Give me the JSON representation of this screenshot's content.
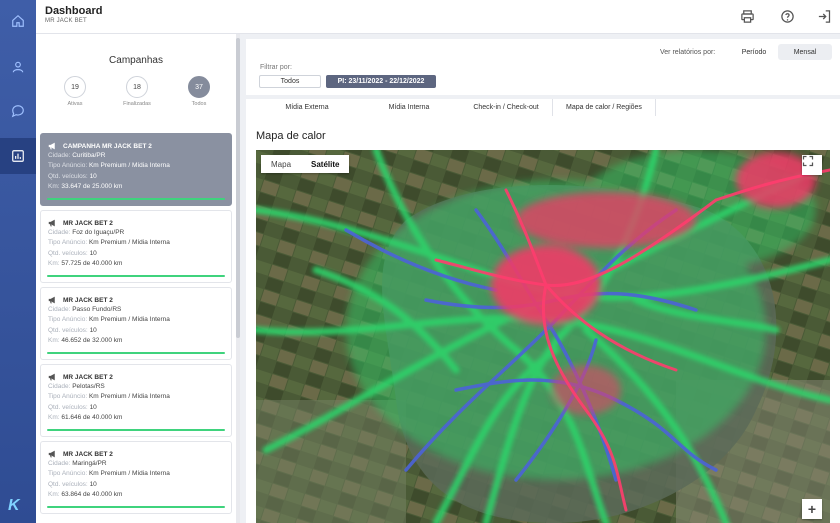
{
  "header": {
    "title": "Dashboard",
    "subtitle": "MR JACK BET"
  },
  "rail": {
    "icons": [
      "home-icon",
      "user-icon",
      "chat-icon",
      "chart-icon"
    ],
    "active": "chart-icon",
    "logo": "K"
  },
  "campaigns": {
    "title": "Campanhas",
    "counters": [
      {
        "value": "19",
        "label": "Ativas"
      },
      {
        "value": "18",
        "label": "Finalizadas"
      },
      {
        "value": "37",
        "label": "Todos"
      }
    ],
    "labels": {
      "cidade": "Cidade:",
      "tipo": "Tipo Anúncio:",
      "qtd": "Qtd. veículos:",
      "km": "Km:"
    },
    "items": [
      {
        "name": "CAMPANHA MR JACK BET 2",
        "cidade": "Curitiba/PR",
        "tipo": "Km Premium / Mídia Interna",
        "qtd": "10",
        "km": "33.647 de 25.000 km"
      },
      {
        "name": "MR JACK BET 2",
        "cidade": "Foz do Iguaçu/PR",
        "tipo": "Km Premium / Mídia Interna",
        "qtd": "10",
        "km": "57.725 de 40.000 km"
      },
      {
        "name": "MR JACK BET 2",
        "cidade": "Passo Fundo/RS",
        "tipo": "Km Premium / Mídia Interna",
        "qtd": "10",
        "km": "46.652 de 32.000 km"
      },
      {
        "name": "MR JACK BET 2",
        "cidade": "Pelotas/RS",
        "tipo": "Km Premium / Mídia Interna",
        "qtd": "10",
        "km": "61.646 de 40.000 km"
      },
      {
        "name": "MR JACK BET 2",
        "cidade": "Maringá/PR",
        "tipo": "Km Premium / Mídia Interna",
        "qtd": "10",
        "km": "63.864 de 40.000 km"
      }
    ]
  },
  "filters": {
    "report_label": "Ver relatórios por:",
    "report_options": [
      "Período",
      "Mensal"
    ],
    "filter_label": "Filtrar por:",
    "todos": "Todos",
    "period": "PI: 23/11/2022 - 22/12/2022"
  },
  "tabs": [
    "Mídia Externa",
    "Mídia Interna",
    "Check-in / Check-out",
    "Mapa de calor / Regiões"
  ],
  "active_tab": "Mapa de calor / Regiões",
  "map": {
    "title": "Mapa de calor",
    "types": [
      "Mapa",
      "Satélite"
    ],
    "active_type": "Satélite",
    "zoom_in": "+"
  },
  "colors": {
    "rail": "#3f5ea8",
    "selected_card": "#8a91a1",
    "progress": "#3fd37d",
    "period_chip": "#5d6680"
  }
}
